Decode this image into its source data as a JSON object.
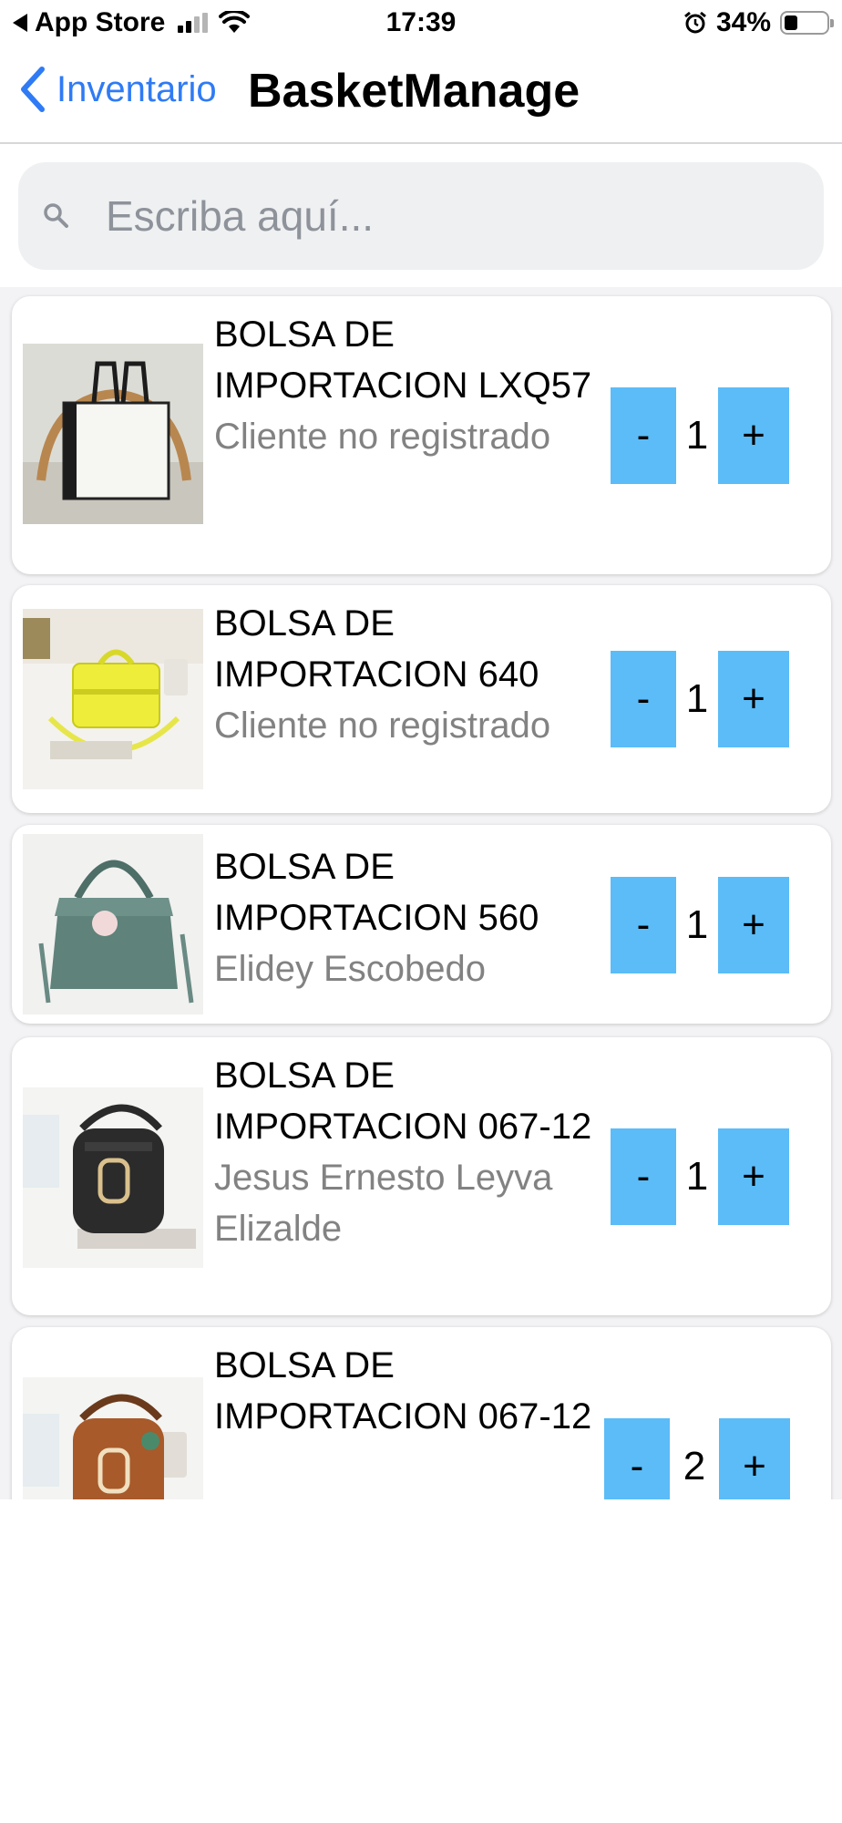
{
  "status_bar": {
    "carrier": "App Store",
    "time": "17:39",
    "battery_percent": "34%",
    "battery_level": 0.34,
    "icons": [
      "back-triangle-icon",
      "signal-icon",
      "wifi-icon",
      "alarm-icon",
      "battery-icon"
    ]
  },
  "nav": {
    "back_label": "Inventario",
    "title": "BasketManage"
  },
  "search": {
    "placeholder": "Escriba aquí...",
    "value": ""
  },
  "items": [
    {
      "name": "BOLSA DE IMPORTACION LXQ57",
      "client": "Cliente no registrado",
      "quantity": "1",
      "minus": "-",
      "plus": "+"
    },
    {
      "name": "BOLSA DE IMPORTACION 640",
      "client": "Cliente no registrado",
      "quantity": "1",
      "minus": "-",
      "plus": "+"
    },
    {
      "name": "BOLSA DE IMPORTACION 560",
      "client": "Elidey Escobedo",
      "quantity": "1",
      "minus": "-",
      "plus": "+"
    },
    {
      "name": "BOLSA DE IMPORTACION 067-12",
      "client": "Jesus Ernesto Leyva Elizalde",
      "quantity": "1",
      "minus": "-",
      "plus": "+"
    },
    {
      "name": "BOLSA DE IMPORTACION 067-12",
      "client": "",
      "quantity": "2",
      "minus": "-",
      "plus": "+"
    }
  ],
  "colors": {
    "accent": "#2f7bf5",
    "qty_button": "#5bbcf8",
    "secondary_text": "#828282"
  }
}
